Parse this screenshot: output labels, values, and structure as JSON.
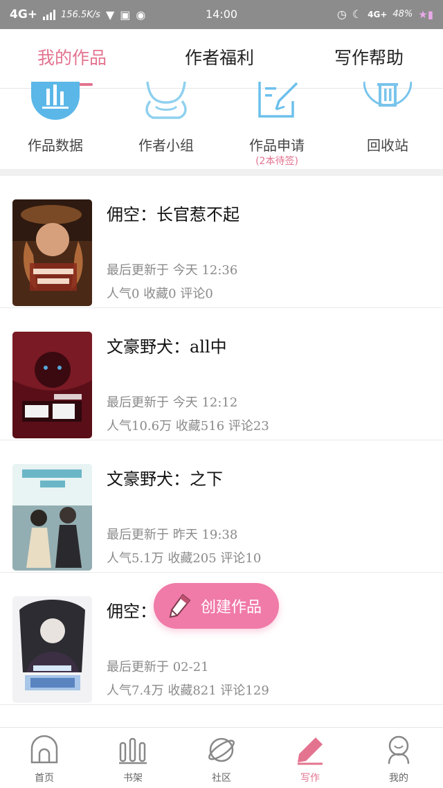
{
  "status_bar": {
    "network": "4G+",
    "speed": "156.5K/s",
    "time": "14:00",
    "network_right": "4G+",
    "battery": "48%"
  },
  "tabs": [
    {
      "label": "我的作品",
      "active": true
    },
    {
      "label": "作者福利",
      "active": false
    },
    {
      "label": "写作帮助",
      "active": false
    }
  ],
  "quick_actions": [
    {
      "label": "作品数据",
      "icon": "bar-chart-icon"
    },
    {
      "label": "作者小组",
      "icon": "group-icon"
    },
    {
      "label": "作品申请",
      "icon": "edit-document-icon",
      "sub": "(2本待签)"
    },
    {
      "label": "回收站",
      "icon": "trash-icon"
    }
  ],
  "works": [
    {
      "title": "佣空：长官惹不起",
      "updated": "最后更新于 今天 12:36",
      "stats": "人气0 收藏0 评论0"
    },
    {
      "title": "文豪野犬：all中",
      "updated": "最后更新于 今天 12:12",
      "stats": "人气10.6万 收藏516 评论23"
    },
    {
      "title": "文豪野犬：之下",
      "updated": "最后更新于 昨天 19:38",
      "stats": "人气5.1万 收藏205 评论10"
    },
    {
      "title": "佣空：",
      "updated": "最后更新于 02-21",
      "stats": "人气7.4万 收藏821 评论129"
    }
  ],
  "create_button": {
    "label": "创建作品"
  },
  "bottom_nav": [
    {
      "label": "首页",
      "icon": "home-icon",
      "active": false
    },
    {
      "label": "书架",
      "icon": "bookshelf-icon",
      "active": false
    },
    {
      "label": "社区",
      "icon": "planet-icon",
      "active": false
    },
    {
      "label": "写作",
      "icon": "pen-icon",
      "active": true
    },
    {
      "label": "我的",
      "icon": "profile-icon",
      "active": false
    }
  ],
  "colors": {
    "accent": "#e3738f",
    "create_button": "#f07aa8",
    "icon_blue": "#5bb7e8",
    "status_bar": "#8c8c8c"
  }
}
